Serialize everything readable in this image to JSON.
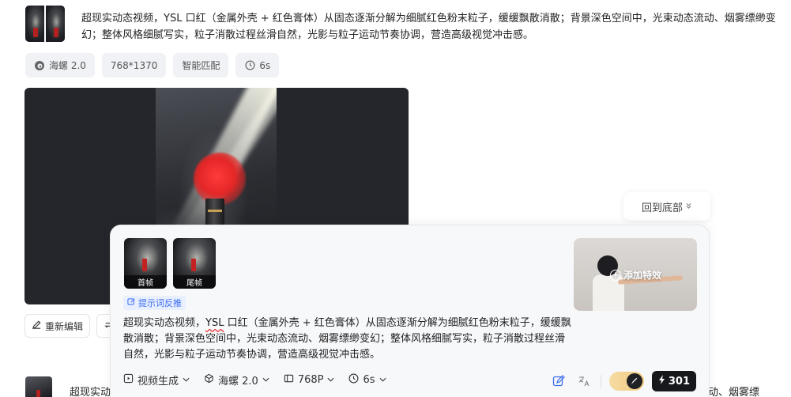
{
  "top_prompt": {
    "text": "超现实动态视频，YSL 口红（金属外壳 + 红色膏体）从固态逐渐分解为细腻红色粉末粒子，缓缓飘散消散；背景深色空间中，光束动态流动、烟雾缥缈变幻；整体风格细腻写实，粒子消散过程丝滑自然，光影与粒子运动节奏协调，营造高级视觉冲击感。"
  },
  "tags": [
    {
      "label": "海螺 2.0",
      "icon": "hailuo-logo-icon"
    },
    {
      "label": "768*1370",
      "icon": ""
    },
    {
      "label": "智能匹配",
      "icon": ""
    },
    {
      "label": "6s",
      "icon": "clock-icon"
    }
  ],
  "actions": {
    "reedit_label": "重新编辑"
  },
  "back_to_bottom": {
    "label": "回到底部"
  },
  "composer": {
    "first_frame_label": "首帧",
    "last_frame_label": "尾帧",
    "effect_label": "添加特效",
    "reverse_prompt_label": "提示词反推",
    "prompt_before": "超现实动态视频，",
    "prompt_flag": "YSL",
    "prompt_after": " 口红（金属外壳 + 红色膏体）从固态逐渐分解为细腻红色粉末粒子，缓缓飘散消散；背景深色空间中，光束动态流动、烟雾缥缈变幻；整体风格细腻写实，粒子消散过程丝滑自然，光影与粒子运动节奏协调，营造高级视觉冲击感。",
    "toolbar": {
      "mode": "视频生成",
      "model": "海螺 2.0",
      "resolution": "768P",
      "duration": "6s"
    },
    "credits": "301"
  },
  "bottom_peek": {
    "left_text": "超现实动",
    "right_text": "态流动、烟雾缥"
  },
  "colors": {
    "accent_blue": "#3c6df0",
    "dark": "#16181c",
    "toggle_gold": "#f0c980"
  }
}
